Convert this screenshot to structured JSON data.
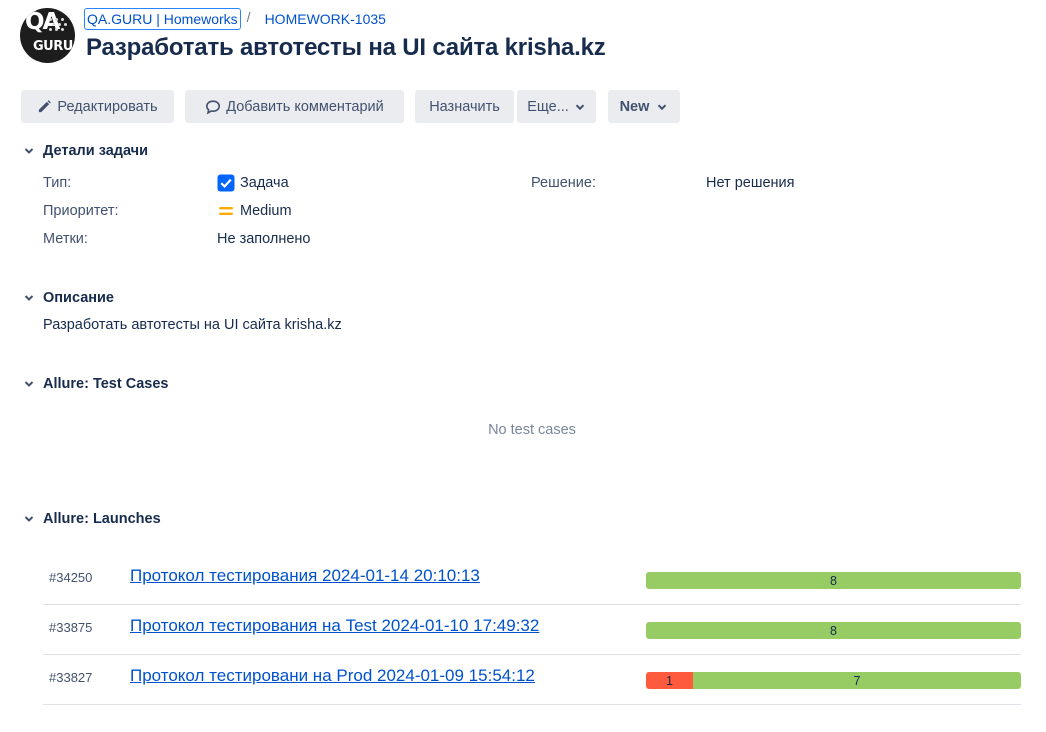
{
  "header": {
    "project_link": "QA.GURU | Homeworks",
    "separator": "/",
    "issue_key": "HOMEWORK-1035",
    "title": "Разработать автотесты на UI сайта krisha.kz",
    "avatar_icon": "qa-guru-logo"
  },
  "toolbar": {
    "edit_label": "Редактировать",
    "comment_label": "Добавить комментарий",
    "assign_label": "Назначить",
    "more_label": "Еще...",
    "status_label": "New"
  },
  "details": {
    "heading": "Детали задачи",
    "type_label": "Тип:",
    "type_value": "Задача",
    "priority_label": "Приоритет:",
    "priority_value": "Medium",
    "labels_label": "Метки:",
    "labels_value": "Не заполнено",
    "resolution_label": "Решение:",
    "resolution_value": "Нет решения"
  },
  "description": {
    "heading": "Описание",
    "text": "Разработать автотесты на UI сайта krisha.kz"
  },
  "test_cases": {
    "heading": "Allure: Test Cases",
    "empty_text": "No test cases"
  },
  "launches": {
    "heading": "Allure: Launches",
    "items": [
      {
        "id": "#34250",
        "name": "Протокол тестирования 2024-01-14 20:10:13",
        "failed": 0,
        "passed": 8,
        "passed_label": "8",
        "failed_label": ""
      },
      {
        "id": "#33875",
        "name": "Протокол тестирования на Test 2024-01-10 17:49:32",
        "failed": 0,
        "passed": 8,
        "passed_label": "8",
        "failed_label": ""
      },
      {
        "id": "#33827",
        "name": "Протокол тестировани на Prod 2024-01-09 15:54:12",
        "failed": 1,
        "passed": 7,
        "passed_label": "7",
        "failed_label": "1"
      }
    ]
  },
  "colors": {
    "link": "#0052cc",
    "passed": "#97cc64",
    "failed": "#fd5a3e",
    "checkbox": "#0065ff",
    "priority": "#ffab00"
  }
}
